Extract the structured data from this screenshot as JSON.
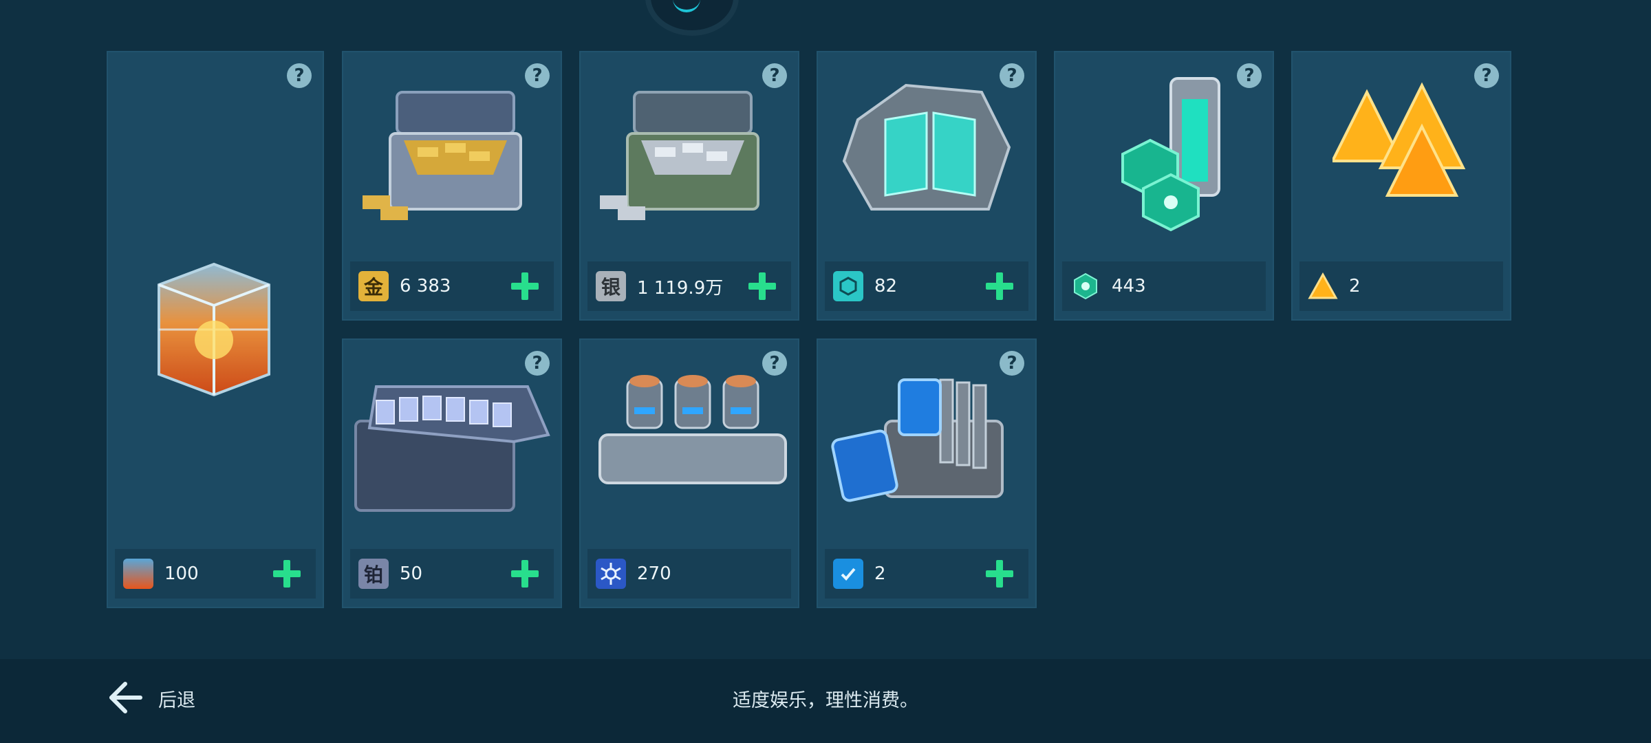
{
  "resources": [
    {
      "id": "fire_cube",
      "icon": "fire-cube-icon",
      "value": "100",
      "has_plus": true
    },
    {
      "id": "gold",
      "icon": "gold-icon",
      "glyph": "金",
      "value": "6 383",
      "has_plus": true
    },
    {
      "id": "silver",
      "icon": "silver-icon",
      "glyph": "银",
      "value": "1 119.9万",
      "has_plus": true
    },
    {
      "id": "crystal",
      "icon": "crystal-icon",
      "value": "82",
      "has_plus": true
    },
    {
      "id": "hex_token",
      "icon": "hex-token-icon",
      "value": "443",
      "has_plus": false
    },
    {
      "id": "pyramid",
      "icon": "pyramid-icon",
      "value": "2",
      "has_plus": false
    },
    {
      "id": "platinum",
      "icon": "platinum-icon",
      "glyph": "铂",
      "value": "50",
      "has_plus": true
    },
    {
      "id": "core",
      "icon": "core-icon",
      "value": "270",
      "has_plus": false
    },
    {
      "id": "module",
      "icon": "module-icon",
      "value": "2",
      "has_plus": true
    }
  ],
  "help_glyph": "?",
  "footer": {
    "back_label": "后退",
    "notice": "适度娱乐，理性消费。"
  },
  "colors": {
    "background": "#0f3042",
    "card": "#1c4a63",
    "plus": "#28de8d",
    "accent": "#1ec4d7"
  }
}
